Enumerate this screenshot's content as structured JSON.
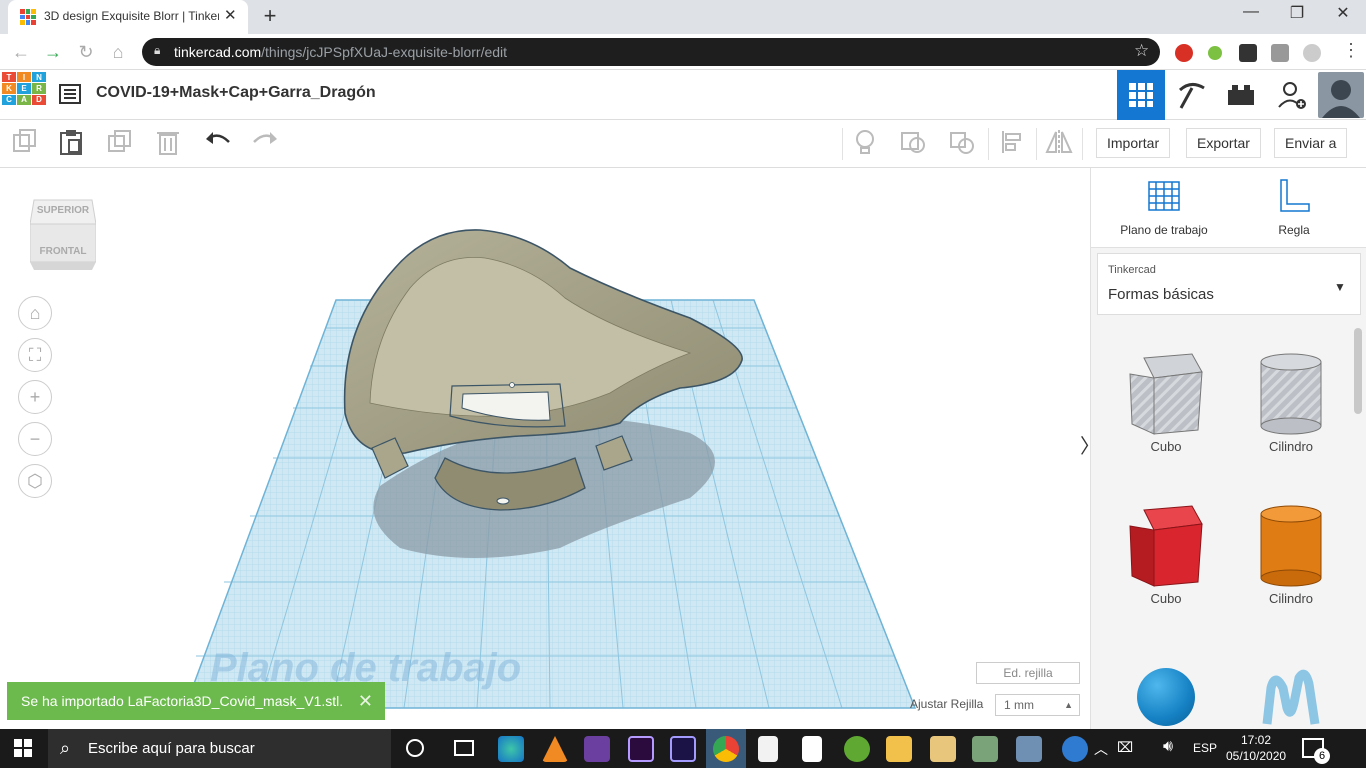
{
  "browser": {
    "tab_title": "3D design Exquisite Blorr | Tinker",
    "url_host": "tinkercad.com",
    "url_path": "/things/jcJPSpfXUaJ-exquisite-blorr/edit"
  },
  "header": {
    "logo_letters": [
      "T",
      "I",
      "N",
      "K",
      "E",
      "R",
      "C",
      "A",
      "D"
    ],
    "design_name": "COVID-19+Mask+Cap+Garra_Dragón"
  },
  "toolbar": {
    "import_label": "Importar",
    "export_label": "Exportar",
    "send_label": "Enviar a"
  },
  "viewcube": {
    "top": "SUPERIOR",
    "front": "FRONTAL"
  },
  "viewport": {
    "workplane_watermark": "Plano de trabajo",
    "edit_grid_label": "Ed. rejilla",
    "snap_grid_label": "Ajustar Rejilla",
    "snap_grid_value": "1 mm",
    "model_color": "#a9a68c",
    "grid_color": "#bfe1f1"
  },
  "toast": {
    "message": "Se ha importado LaFactoria3D_Covid_mask_V1.stl."
  },
  "panel": {
    "workplane_label": "Plano de trabajo",
    "ruler_label": "Regla",
    "library_category": "Tinkercad",
    "library_name": "Formas básicas",
    "shapes": [
      {
        "label": "Cubo",
        "color": "#b0b4ba"
      },
      {
        "label": "Cilindro",
        "color": "#b0b4ba"
      },
      {
        "label": "Cubo",
        "color": "#d9262e"
      },
      {
        "label": "Cilindro",
        "color": "#e07c14"
      }
    ]
  },
  "taskbar": {
    "search_placeholder": "Escribe aquí para buscar",
    "lang": "ESP",
    "time": "17:02",
    "date": "05/10/2020",
    "notifications": "6"
  }
}
